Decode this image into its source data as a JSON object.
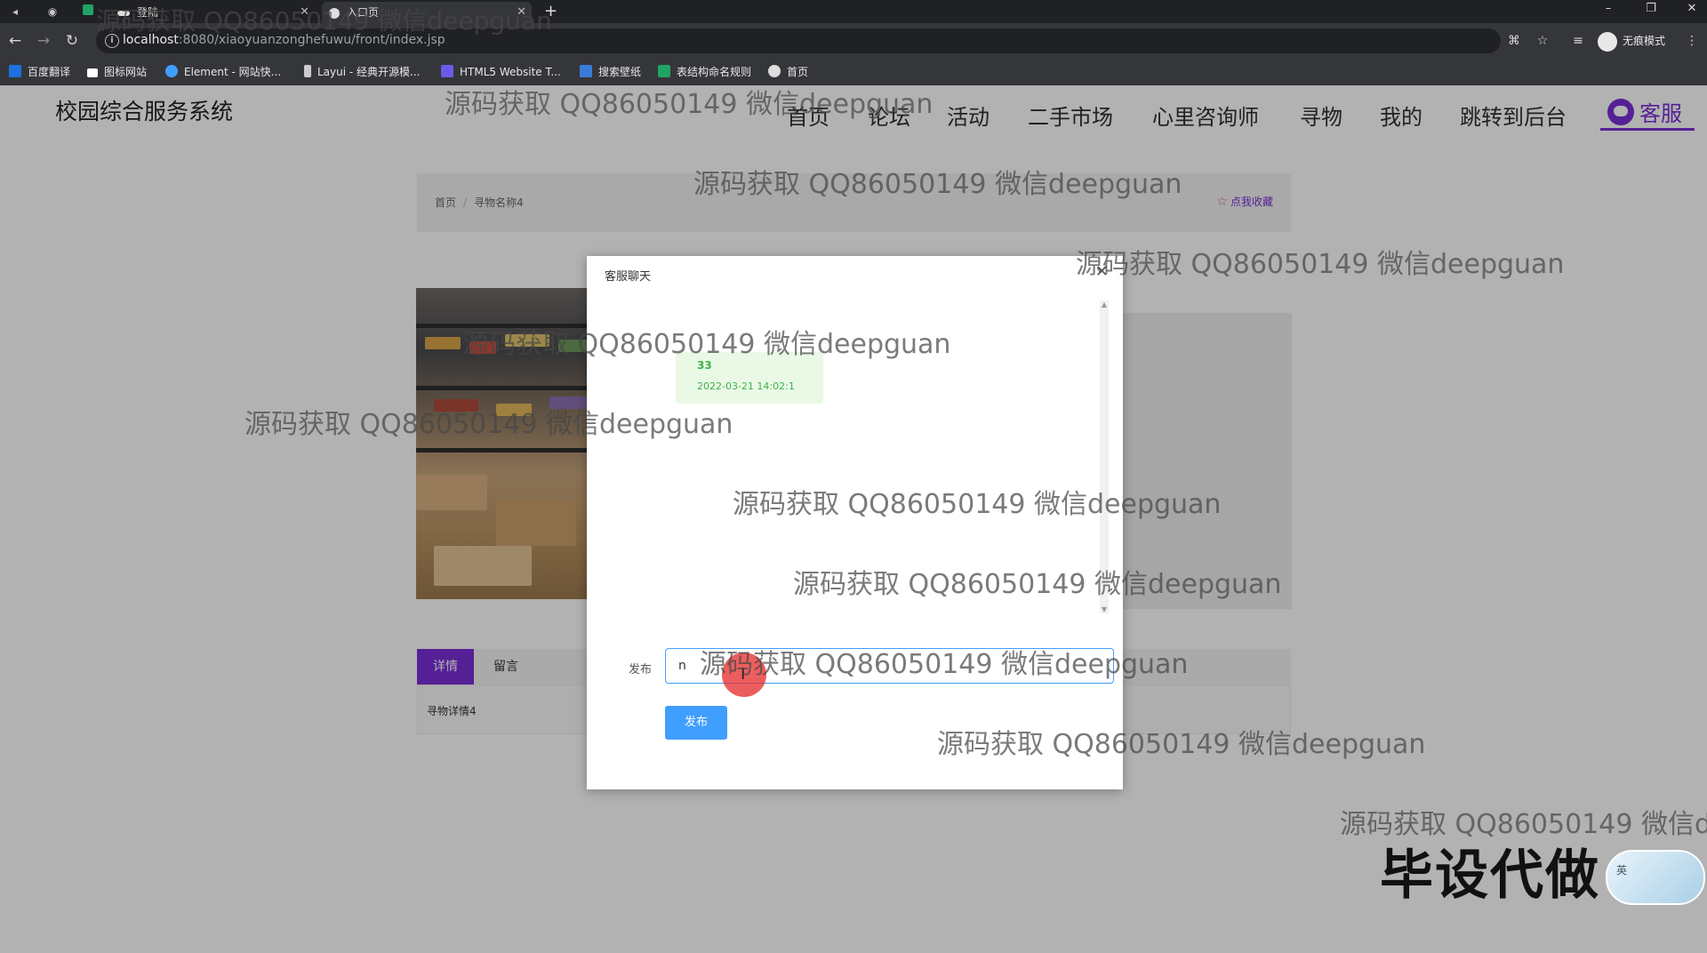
{
  "browser": {
    "tabs": [
      {
        "label": "登陆"
      },
      {
        "label": "入口页"
      }
    ],
    "url_host": "localhost",
    "url_path": ":8080/xiaoyuanzonghefuwu/front/index.jsp",
    "incognito_label": "无痕模式",
    "bookmarks": [
      {
        "label": "百度翻译",
        "icon": "translate-icon",
        "color": "#1e6fe0"
      },
      {
        "label": "图标网站",
        "icon": "flag-icon",
        "color": "#ffffff"
      },
      {
        "label": "Element - 网站快...",
        "icon": "element-icon",
        "color": "#409eff"
      },
      {
        "label": "Layui - 经典开源模...",
        "icon": "layui-icon",
        "color": "#cccccc"
      },
      {
        "label": "HTML5 Website T...",
        "icon": "html5-icon",
        "color": "#6b5ce7"
      },
      {
        "label": "搜索壁纸",
        "icon": "wallpaper-icon",
        "color": "#3b7bd8"
      },
      {
        "label": "表结构命名规则",
        "icon": "sheet-icon",
        "color": "#21a366"
      },
      {
        "label": "首页",
        "icon": "globe-icon",
        "color": "#dddddd"
      }
    ]
  },
  "site": {
    "title": "校园综合服务系统",
    "nav": [
      "首页",
      "论坛",
      "活动",
      "二手市场",
      "心里咨询师",
      "寻物",
      "我的",
      "跳转到后台"
    ],
    "service_label": "客服"
  },
  "breadcrumb": {
    "home": "首页",
    "separator": "/",
    "current": "寻物名称4",
    "favorite": "点我收藏"
  },
  "detail_tabs": {
    "active": "详情",
    "inactive": "留言",
    "content": "寻物详情4"
  },
  "dialog": {
    "title": "客服聊天",
    "message": {
      "text": "33",
      "time": "2022-03-21 14:02:1"
    },
    "form_label": "发布",
    "input_value": "n",
    "submit_label": "发布"
  },
  "watermark_text": "源码获取 QQ86050149 微信deepguan",
  "brand_text": "毕设代做",
  "mascot_label": "英",
  "colors": {
    "accent": "#7a2fd6",
    "primary_button": "#409eff",
    "chat_green": "#3db24a"
  }
}
